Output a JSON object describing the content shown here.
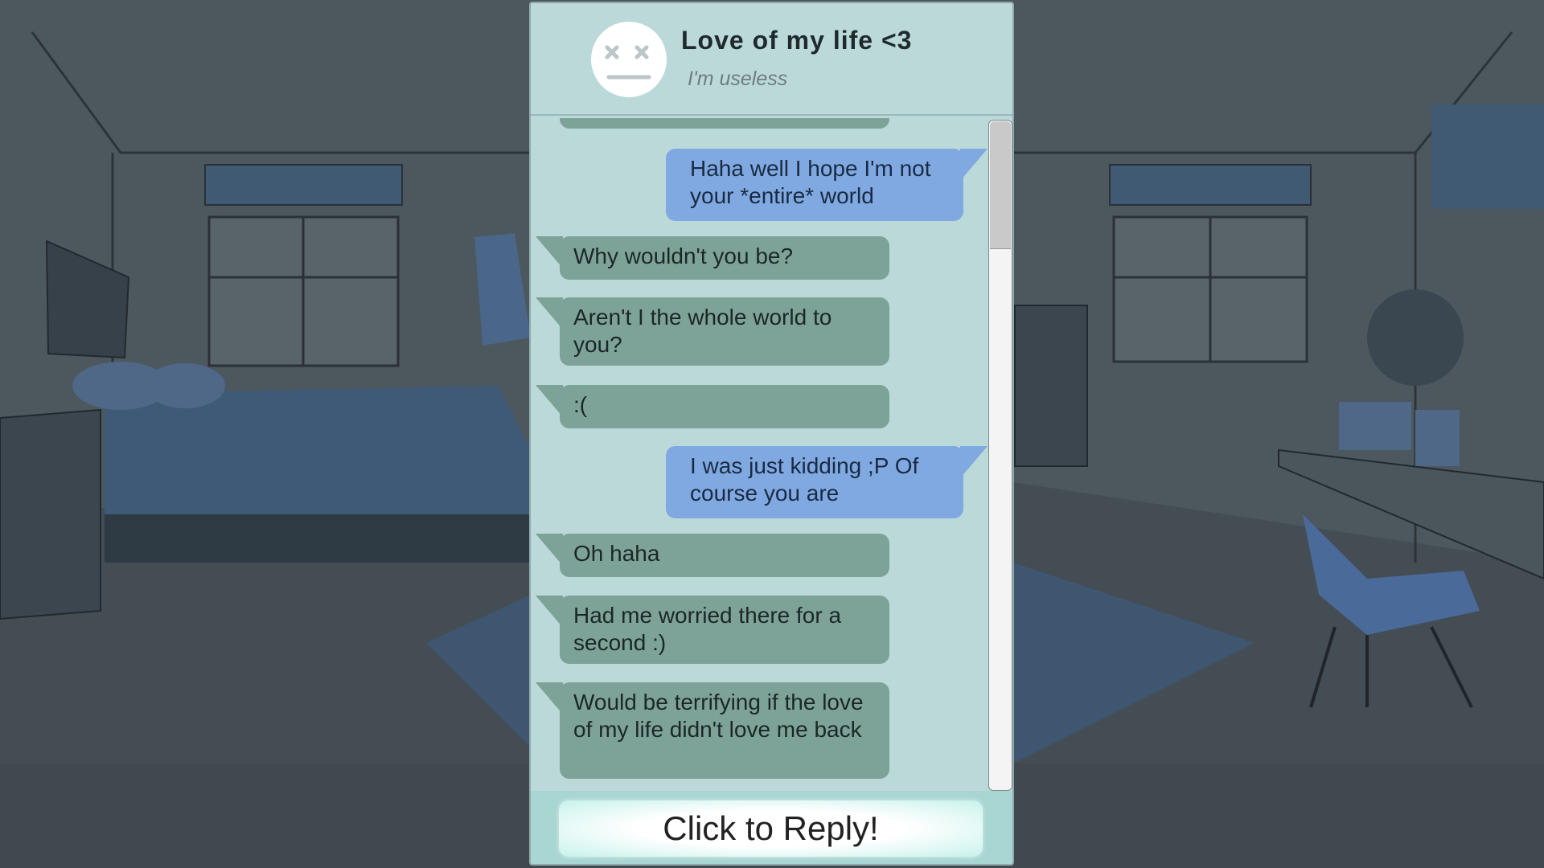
{
  "header": {
    "contact_name": "Love of my life <3",
    "contact_status": "I'm useless",
    "avatar_icon": "dizzy-face-icon"
  },
  "messages": [
    {
      "sender": "them",
      "text": ""
    },
    {
      "sender": "me",
      "text": "Haha well I hope I'm not your *entire* world"
    },
    {
      "sender": "them",
      "text": "Why wouldn't you be?"
    },
    {
      "sender": "them",
      "text": "Aren't I the whole world to you?"
    },
    {
      "sender": "them",
      "text": ":("
    },
    {
      "sender": "me",
      "text": "I was just kidding ;P Of course you are"
    },
    {
      "sender": "them",
      "text": "Oh haha"
    },
    {
      "sender": "them",
      "text": "Had me worried there for a second :)"
    },
    {
      "sender": "them",
      "text": "Would be terrifying if the love of my life didn't love me back"
    }
  ],
  "footer": {
    "reply_label": "Click to Reply!"
  },
  "colors": {
    "panel": "#bcd9d9",
    "their_bubble": "#7da398",
    "my_bubble": "#7fa9e0",
    "footer": "#a8d6d2"
  }
}
